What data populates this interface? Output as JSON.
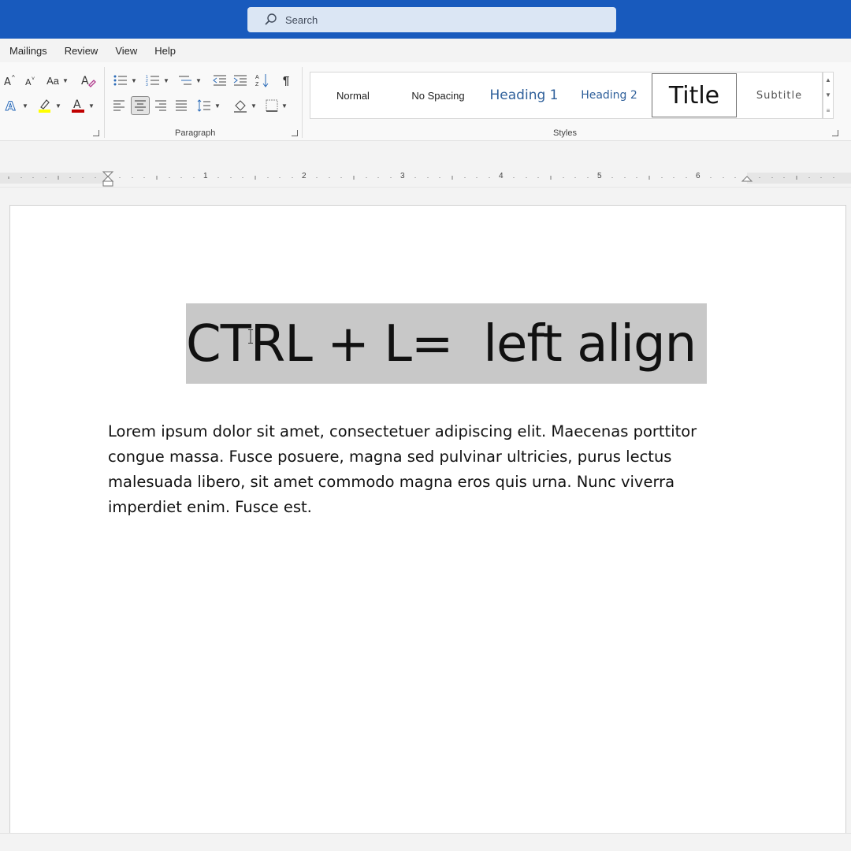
{
  "search": {
    "placeholder": "Search"
  },
  "tabs": [
    "Mailings",
    "Review",
    "View",
    "Help"
  ],
  "ribbon": {
    "font_group": {
      "change_case_label": "Aa"
    },
    "paragraph_label": "Paragraph",
    "styles_label": "Styles",
    "styles": [
      {
        "label": "Normal"
      },
      {
        "label": "No Spacing"
      },
      {
        "label": "Heading 1"
      },
      {
        "label": "Heading 2"
      },
      {
        "label": "Title",
        "active": true
      },
      {
        "label": "Subtitle"
      }
    ]
  },
  "ruler": {
    "numbers": [
      "1",
      "2",
      "3",
      "4",
      "5",
      "6"
    ]
  },
  "document": {
    "title": "CTRL + L=  left align",
    "body": "Lorem ipsum dolor sit amet, consectetuer adipiscing elit. Maecenas porttitor congue massa. Fusce posuere, magna sed pulvinar ultricies, purus lectus malesuada libero, sit amet commodo magna eros quis urna. Nunc viverra imperdiet enim. Fusce est."
  },
  "colors": {
    "titlebar": "#185abd",
    "highlight": "#ffff00",
    "font_color": "#c00000",
    "selection": "#c8c8c8"
  }
}
